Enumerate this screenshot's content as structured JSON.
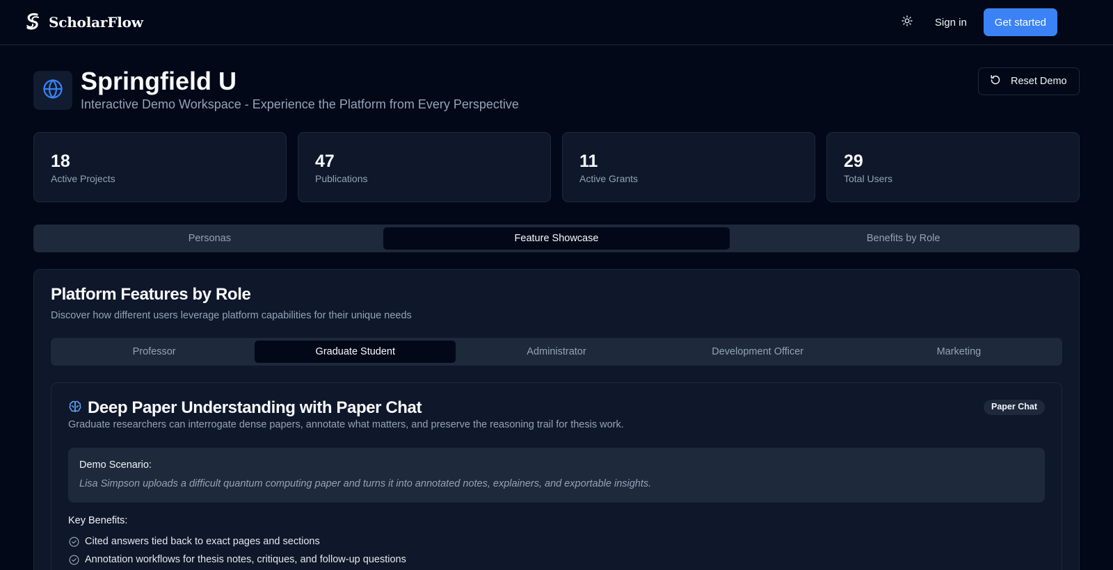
{
  "nav": {
    "brand": "ScholarFlow",
    "sign_in": "Sign in",
    "get_started": "Get started"
  },
  "header": {
    "title": "Springfield U",
    "subtitle": "Interactive Demo Workspace - Experience the Platform from Every Perspective",
    "reset_label": "Reset Demo"
  },
  "stats": [
    {
      "value": "18",
      "label": "Active Projects"
    },
    {
      "value": "47",
      "label": "Publications"
    },
    {
      "value": "11",
      "label": "Active Grants"
    },
    {
      "value": "29",
      "label": "Total Users"
    }
  ],
  "main_tabs": [
    {
      "label": "Personas",
      "active": false
    },
    {
      "label": "Feature Showcase",
      "active": true
    },
    {
      "label": "Benefits by Role",
      "active": false
    }
  ],
  "panel": {
    "title": "Platform Features by Role",
    "subtitle": "Discover how different users leverage platform capabilities for their unique needs",
    "role_tabs": [
      {
        "label": "Professor",
        "active": false
      },
      {
        "label": "Graduate Student",
        "active": true
      },
      {
        "label": "Administrator",
        "active": false
      },
      {
        "label": "Development Officer",
        "active": false
      },
      {
        "label": "Marketing",
        "active": false
      }
    ]
  },
  "feature": {
    "icon": "brain-icon",
    "title": "Deep Paper Understanding with Paper Chat",
    "badge": "Paper Chat",
    "description": "Graduate researchers can interrogate dense papers, annotate what matters, and preserve the reasoning trail for thesis work.",
    "scenario_label": "Demo Scenario:",
    "scenario_text": "Lisa Simpson uploads a difficult quantum computing paper and turns it into annotated notes, explainers, and exportable insights.",
    "benefits_label": "Key Benefits:",
    "benefits": [
      "Cited answers tied back to exact pages and sections",
      "Annotation workflows for thesis notes, critiques, and follow-up questions"
    ]
  },
  "colors": {
    "background": "#020817",
    "card": "#0f172a",
    "border": "#1e293b",
    "accent": "#3b82f6",
    "muted_text": "#94a3b8"
  }
}
